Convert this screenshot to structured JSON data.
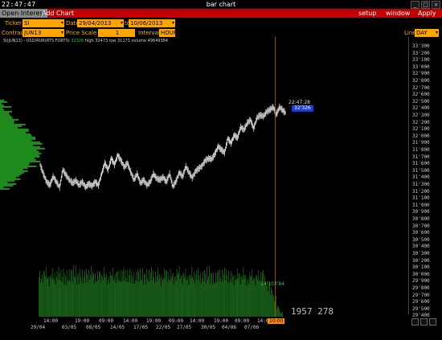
{
  "window": {
    "clock": "22:47:47",
    "title": "bar chart",
    "buttons": [
      "_",
      "□",
      "×"
    ]
  },
  "menu": {
    "open_interest": "Open Interest",
    "add_chart": "Add Chart",
    "setup": "setup",
    "window": "window",
    "apply": "Apply"
  },
  "toolbar": {
    "ticker_label": "Ticker",
    "ticker_value": "SI",
    "date_label": "Date",
    "date_from": "29/04/2013",
    "date_sep": "to",
    "date_to": "10/06/2013",
    "contract_label": "Contract",
    "contract_value": "JUN13",
    "price_scale_label": "Price Scale",
    "price_scale_value": "1",
    "interval_label": "Interval",
    "interval_value": "HOUR",
    "line_label": "Line",
    "line_value": "DAY"
  },
  "info": {
    "symbol": "SI(JUN13) - USD/RUR(RTS FORTS)",
    "last": "32326",
    "high": "high 32473",
    "low": "low 31173",
    "volume": "volume 49649384"
  },
  "overlay": {
    "time_tag": "22:47:28",
    "price_tag": "32'326",
    "volume_label": "24'103'84",
    "big_value": "1957 278",
    "x_highlight": "10:00"
  },
  "colors": {
    "menu_bg": "#c00000",
    "field_bg": "#ffa500",
    "price_tag_bg": "#1c3cd8",
    "volume_green": "#1f7a1f",
    "price_line": "#e8e8e8"
  },
  "chart_data": {
    "type": "line",
    "y_ticks": [
      "33'300",
      "33'200",
      "33'100",
      "33'000",
      "32'900",
      "32'800",
      "32'700",
      "32'600",
      "32'500",
      "32'400",
      "32'300",
      "32'200",
      "32'100",
      "32'000",
      "31'900",
      "31'800",
      "31'700",
      "31'600",
      "31'500",
      "31'400",
      "31'300",
      "31'200",
      "31'100",
      "31'000",
      "30'900",
      "30'800",
      "30'700",
      "30'600",
      "30'500",
      "30'400",
      "30'300",
      "30'200",
      "30'100",
      "30'000",
      "29'900",
      "29'800",
      "29'700",
      "29'600",
      "29'500",
      "29'400"
    ],
    "x_ticks_top": [
      "14:00",
      "19:00",
      "09:00",
      "14:00",
      "19:00",
      "09:00",
      "14:00",
      "19:00",
      "09:00",
      "14:00"
    ],
    "x_ticks_bottom": [
      "29/04",
      "03/05",
      "08/05",
      "14/05",
      "17/05",
      "22/05",
      "27/05",
      "30/05",
      "04/06",
      "07/06"
    ],
    "ylim": [
      29400,
      33350
    ],
    "price": [
      31555,
      31420,
      31300,
      31250,
      31380,
      31300,
      31220,
      31480,
      31400,
      31330,
      31280,
      31320,
      31250,
      31300,
      31220,
      31270,
      31240,
      31300,
      31250,
      31420,
      31580,
      31480,
      31650,
      31560,
      31700,
      31620,
      31520,
      31580,
      31450,
      31330,
      31420,
      31280,
      31330,
      31250,
      31300,
      31420,
      31350,
      31330,
      31370,
      31300,
      31420,
      31230,
      31310,
      31440,
      31380,
      31530,
      31440,
      31360,
      31460,
      31500,
      31540,
      31620,
      31650,
      31640,
      31720,
      31830,
      31780,
      31740,
      31950,
      31880,
      32000,
      31960,
      32120,
      32080,
      32180,
      32230,
      32100,
      32260,
      32300,
      32280,
      32350,
      32380,
      32420,
      32310,
      32420,
      32370,
      32326
    ],
    "volume": [
      58,
      60,
      62,
      55,
      61,
      58,
      63,
      60,
      56,
      59,
      62,
      64,
      57,
      60,
      58,
      61,
      63,
      59,
      57,
      60,
      62,
      55,
      58,
      61,
      60,
      57,
      63,
      59,
      61,
      58,
      56,
      62,
      60,
      57,
      59,
      63,
      58,
      61,
      55,
      60,
      62,
      59,
      57,
      61,
      64,
      58,
      60,
      56,
      62,
      59,
      61,
      57,
      60,
      63,
      58,
      55,
      61,
      59,
      62,
      60,
      57,
      56,
      60,
      58,
      62,
      54,
      57,
      60,
      55,
      58,
      61,
      52,
      45,
      38,
      26,
      14,
      6
    ]
  }
}
